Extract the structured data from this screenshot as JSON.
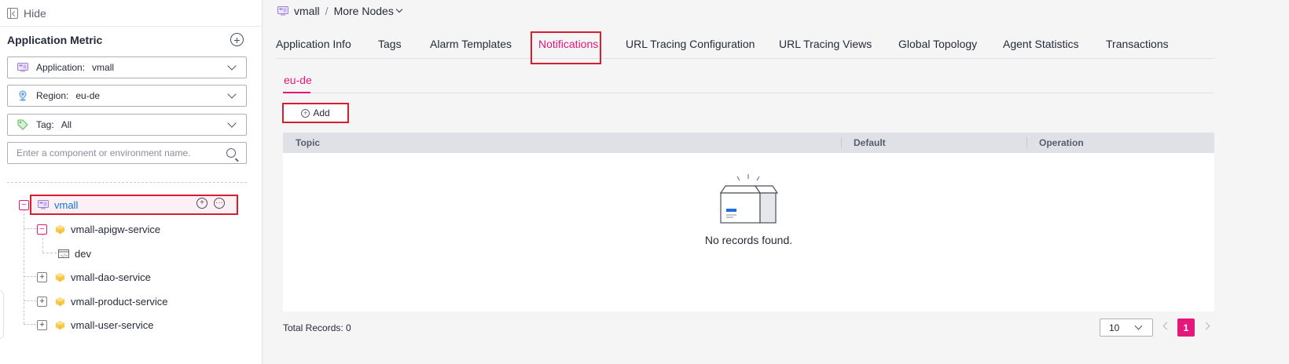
{
  "sidebar": {
    "hide_label": "Hide",
    "title": "Application Metric",
    "filters": [
      {
        "key": "Application:",
        "value": "vmall",
        "icon": "application-icon"
      },
      {
        "key": "Region:",
        "value": "eu-de",
        "icon": "location-pin-icon"
      },
      {
        "key": "Tag:",
        "value": "All",
        "icon": "tag-icon"
      }
    ],
    "search_placeholder": "Enter a component or environment name.",
    "tree": {
      "root": "vmall",
      "children": [
        {
          "label": "vmall-apigw-service",
          "expanded": true,
          "children": [
            {
              "label": "dev"
            }
          ]
        },
        {
          "label": "vmall-dao-service",
          "expanded": false
        },
        {
          "label": "vmall-product-service",
          "expanded": false
        },
        {
          "label": "vmall-user-service",
          "expanded": false
        }
      ]
    }
  },
  "header": {
    "breadcrumb_app": "vmall",
    "breadcrumb_sep": "/",
    "breadcrumb_more": "More Nodes"
  },
  "tabs": [
    "Application Info",
    "Tags",
    "Alarm Templates",
    "Notifications",
    "URL Tracing Configuration",
    "URL Tracing Views",
    "Global Topology",
    "Agent Statistics",
    "Transactions"
  ],
  "active_tab": "Notifications",
  "subtab": "eu-de",
  "add_label": "Add",
  "table": {
    "columns": [
      "Topic",
      "Default",
      "Operation"
    ],
    "empty_text": "No records found."
  },
  "footer": {
    "total": "Total Records: 0",
    "page_size": "10",
    "current_page": "1"
  },
  "colors": {
    "accent": "#e3187a",
    "highlight_box": "#d61f2c",
    "link": "#0e72d8"
  }
}
